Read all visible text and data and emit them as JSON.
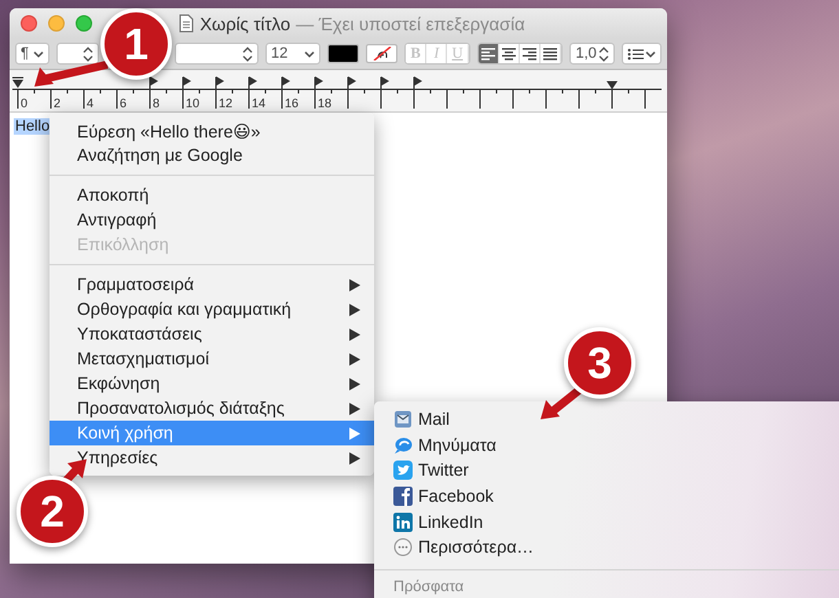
{
  "window": {
    "title": "Χωρίς τίτλο",
    "subtitle": "— Έχει υποστεί επεξεργασία"
  },
  "toolbar": {
    "paragraph_style": "¶",
    "font_size": "12",
    "line_spacing": "1,0",
    "style_buttons": [
      {
        "label": "B",
        "disabled": true
      },
      {
        "label": "I",
        "disabled": true
      },
      {
        "label": "U",
        "disabled": true
      }
    ],
    "alignments": [
      {
        "kind": "left",
        "selected": true
      },
      {
        "kind": "center",
        "selected": false
      },
      {
        "kind": "right",
        "selected": false
      },
      {
        "kind": "justify",
        "selected": false
      }
    ]
  },
  "ruler": {
    "labels": [
      "0",
      "2",
      "4",
      "6",
      "8",
      "10",
      "12",
      "14",
      "16",
      "18"
    ]
  },
  "document": {
    "text": "Hello",
    "selected": true
  },
  "context_menu": {
    "sections": [
      [
        {
          "label": "Εύρεση «Hello there😃»",
          "disabled": false,
          "submenu": false,
          "selected": false
        },
        {
          "label": "Αναζήτηση με Google",
          "disabled": false,
          "submenu": false,
          "selected": false
        }
      ],
      [
        {
          "label": "Αποκοπή",
          "disabled": false,
          "submenu": false,
          "selected": false
        },
        {
          "label": "Αντιγραφή",
          "disabled": false,
          "submenu": false,
          "selected": false
        },
        {
          "label": "Επικόλληση",
          "disabled": true,
          "submenu": false,
          "selected": false
        }
      ],
      [
        {
          "label": "Γραμματοσειρά",
          "disabled": false,
          "submenu": true,
          "selected": false
        },
        {
          "label": "Ορθογραφία και γραμματική",
          "disabled": false,
          "submenu": true,
          "selected": false
        },
        {
          "label": "Υποκαταστάσεις",
          "disabled": false,
          "submenu": true,
          "selected": false
        },
        {
          "label": "Μετασχηματισμοί",
          "disabled": false,
          "submenu": true,
          "selected": false
        },
        {
          "label": "Εκφώνηση",
          "disabled": false,
          "submenu": true,
          "selected": false
        },
        {
          "label": "Προσανατολισμός διάταξης",
          "disabled": false,
          "submenu": true,
          "selected": false
        },
        {
          "label": "Κοινή χρήση",
          "disabled": false,
          "submenu": true,
          "selected": true
        },
        {
          "label": "Υπηρεσίες",
          "disabled": false,
          "submenu": true,
          "selected": false
        }
      ]
    ]
  },
  "share_menu": {
    "items": [
      {
        "label": "Mail",
        "kind": "mail"
      },
      {
        "label": "Μηνύματα",
        "kind": "messages"
      },
      {
        "label": "Twitter",
        "kind": "twitter"
      },
      {
        "label": "Facebook",
        "kind": "facebook"
      },
      {
        "label": "LinkedIn",
        "kind": "linkedin"
      },
      {
        "label": "Περισσότερα…",
        "kind": "more"
      }
    ],
    "section_header": "Πρόσφατα"
  },
  "annotations": [
    {
      "label": "1",
      "kind": "down-left"
    },
    {
      "label": "2",
      "kind": "up-right"
    },
    {
      "label": "3",
      "kind": "down-left"
    }
  ]
}
